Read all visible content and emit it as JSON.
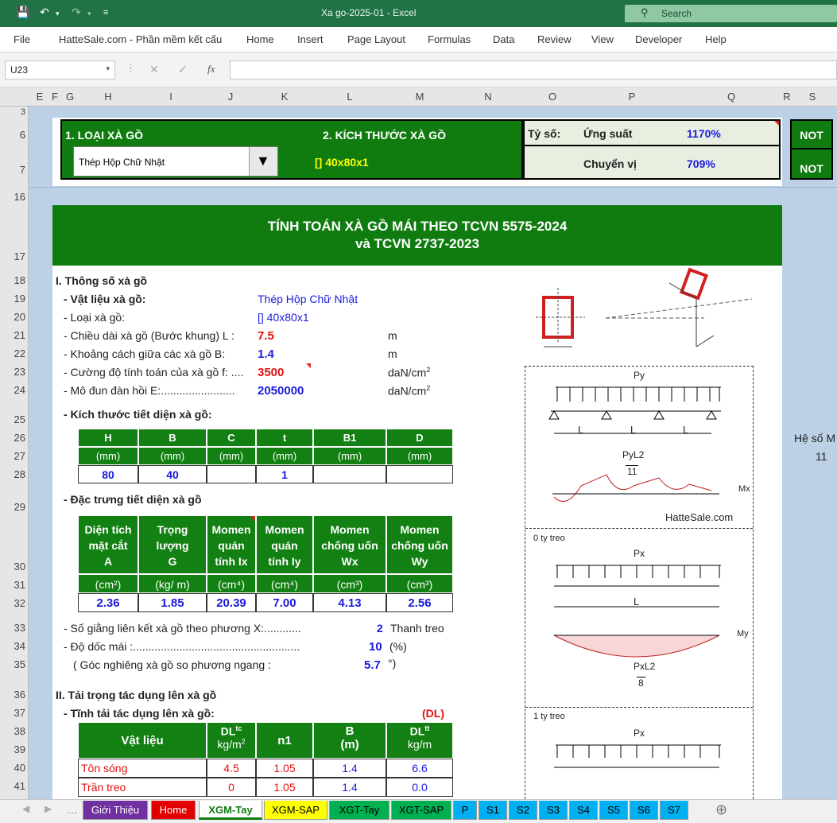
{
  "title_bar": {
    "title": "Xa go-2025-01  -  Excel",
    "search_placeholder": "Search"
  },
  "ribbon": {
    "tabs": [
      "File",
      "HatteSale.com - Phần mềm kết cấu",
      "Home",
      "Insert",
      "Page Layout",
      "Formulas",
      "Data",
      "Review",
      "View",
      "Developer",
      "Help"
    ]
  },
  "formula_bar": {
    "name_box": "U23",
    "fx": "fx",
    "content": ""
  },
  "columns": [
    "E",
    "F",
    "G",
    "H",
    "I",
    "J",
    "K",
    "L",
    "M",
    "N",
    "O",
    "P",
    "Q",
    "R",
    "S"
  ],
  "rows": [
    "3",
    "6",
    "7",
    "16",
    "17",
    "18",
    "19",
    "20",
    "21",
    "22",
    "23",
    "24",
    "25",
    "26",
    "27",
    "28",
    "29",
    "30",
    "31",
    "32",
    "33",
    "34",
    "35",
    "36",
    "37",
    "38",
    "39",
    "40",
    "41"
  ],
  "header_box": {
    "loai_label": "1. LOẠI  XÀ GỒ",
    "loai_value": "Thép Hộp Chữ Nhật",
    "kt_label": "2. KÍCH THƯỚC  XÀ GỒ",
    "kt_value": "[] 40x80x1",
    "ty_so": "Tỷ số:",
    "ung_suat": "Ứng suất",
    "ung_suat_val": "1170%",
    "chuyen_vi": "Chuyển vị",
    "chuyen_vi_val": "709%",
    "not1": "NOT",
    "not2": "NOT"
  },
  "main_title": {
    "line1": "TÍNH TOÁN XÀ GỒ MÁI THEO TCVN 5575-2024",
    "line2": "và TCVN 2737-2023"
  },
  "section1": {
    "heading": "I. Thông số xà gồ",
    "vat_lieu_label": "- Vật liệu xà gồ:",
    "vat_lieu_val": "Thép Hộp Chữ Nhật",
    "loai_label": "- Loại xà gồ:",
    "loai_val": "[] 40x80x1",
    "L_label": "- Chiều dài xà gồ (Bước khung) L :",
    "L_val": "7.5",
    "L_unit": "m",
    "B_label": "- Khoảng cách giữa các xà gồ B:",
    "B_val": "1.4",
    "B_unit": "m",
    "f_label": "- Cường độ tính toán của xà gồ f: ....",
    "f_val": "3500",
    "f_unit": "daN/cm",
    "E_label": "- Mô đun đàn hồi E:........................",
    "E_val": "2050000",
    "E_unit": "daN/cm",
    "kt_heading": "- Kích thước tiết diện xà gồ:",
    "kt_headers": [
      "H",
      "B",
      "C",
      "t",
      "B1",
      "D"
    ],
    "kt_units": [
      "(mm)",
      "(mm)",
      "(mm)",
      "(mm)",
      "(mm)",
      "(mm)"
    ],
    "kt_values": [
      "80",
      "40",
      "",
      "1",
      "",
      ""
    ],
    "dt_heading": "- Đặc trưng tiết diện xà gồ",
    "dt_headers": [
      "Diện tích\nmặt cắt\nA",
      "Trọng\nlượng\nG",
      "Momen\nquán\ntính Ix",
      "Momen\nquán\ntính Iy",
      "Momen\nchống uốn\nWx",
      "Momen\nchống uốn\nWy"
    ],
    "dt_units": [
      "(cm²)",
      "(kg/ m)",
      "(cm⁴)",
      "(cm⁴)",
      "(cm³)",
      "(cm³)"
    ],
    "dt_values": [
      "2.36",
      "1.85",
      "20.39",
      "7.00",
      "4.13",
      "2.56"
    ],
    "giang_label": "- Số giằng liên kết xà gồ theo phương X:............",
    "giang_val": "2",
    "giang_unit": "Thanh treo",
    "doc_label": "- Độ dốc mái :......................................................",
    "doc_val": "10",
    "doc_unit": "(%)",
    "goc_label": "( Góc nghiêng xà gồ so phương ngang :",
    "goc_val": "5.7",
    "goc_unit": "°)"
  },
  "section2": {
    "heading": "II. Tải trọng tác dụng lên xà gồ",
    "tinh_tai": "- Tĩnh tải tác dụng lên xà gồ:",
    "dl": "(DL)",
    "headers": [
      "Vật liệu",
      "DLtc",
      "n1",
      "B",
      "DLtt"
    ],
    "units": [
      "",
      "kg/m2",
      "",
      "(m)",
      "kg/m"
    ],
    "rows": [
      [
        "Tôn sóng",
        "4.5",
        "1.05",
        "1.4",
        "6.6"
      ],
      [
        "Trần treo",
        "0",
        "1.05",
        "1.4",
        "0.0"
      ]
    ]
  },
  "side": {
    "he_so": "Hệ số M",
    "he_so_val": "11"
  },
  "diagrams": {
    "py": "Py",
    "l": "L",
    "py_l2": "PyL2",
    "eleven": "11",
    "mx": "Mx",
    "brand": "HatteSale.com",
    "zero_treo": "0 ty treo",
    "px": "Px",
    "my": "My",
    "px_l2": "PxL2",
    "eight": "8",
    "one_treo": "1 ty treo"
  },
  "sheet_tabs": [
    {
      "label": "Giới Thiệu",
      "color": "#7030a0",
      "text": "#fff"
    },
    {
      "label": "Home",
      "color": "#e00000",
      "text": "#fff"
    },
    {
      "label": "XGM-Tay",
      "color": "#ffffff",
      "text": "#107c10"
    },
    {
      "label": "XGM-SAP",
      "color": "#ffff00",
      "text": "#000"
    },
    {
      "label": "XGT-Tay",
      "color": "#00b050",
      "text": "#000"
    },
    {
      "label": "XGT-SAP",
      "color": "#00b050",
      "text": "#000"
    },
    {
      "label": "P",
      "color": "#00b0f0",
      "text": "#000"
    },
    {
      "label": "S1",
      "color": "#00b0f0",
      "text": "#000"
    },
    {
      "label": "S2",
      "color": "#00b0f0",
      "text": "#000"
    },
    {
      "label": "S3",
      "color": "#00b0f0",
      "text": "#000"
    },
    {
      "label": "S4",
      "color": "#00b0f0",
      "text": "#000"
    },
    {
      "label": "S5",
      "color": "#00b0f0",
      "text": "#000"
    },
    {
      "label": "S6",
      "color": "#00b0f0",
      "text": "#000"
    },
    {
      "label": "S7",
      "color": "#00b0f0",
      "text": "#000"
    }
  ]
}
